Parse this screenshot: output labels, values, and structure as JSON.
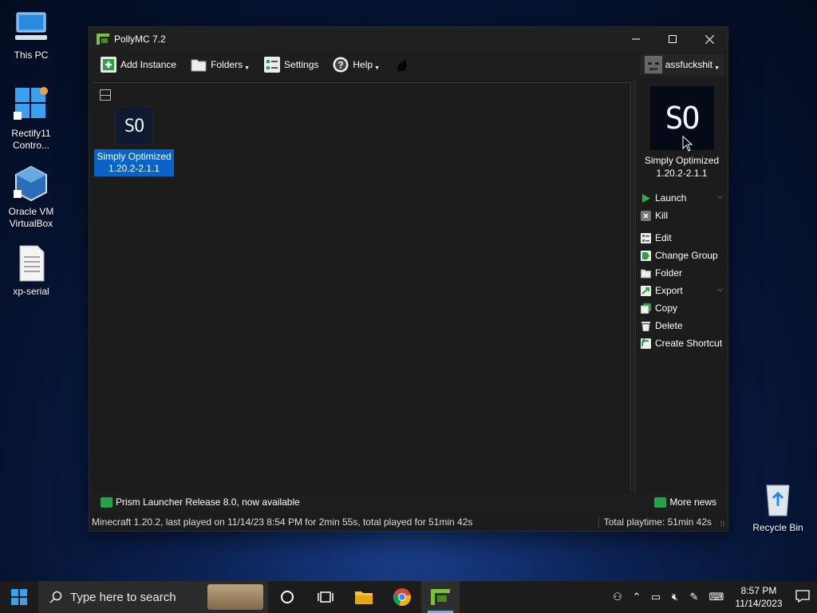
{
  "desktop": {
    "icons": [
      {
        "label": "This PC"
      },
      {
        "label": "Rectify11 Contro..."
      },
      {
        "label": "Oracle VM VirtualBox"
      },
      {
        "label": "xp-serial"
      },
      {
        "label": "Recycle Bin"
      }
    ]
  },
  "window": {
    "title": "PollyMC 7.2",
    "toolbar": {
      "add_instance": "Add Instance",
      "folders": "Folders",
      "settings": "Settings",
      "help": "Help",
      "account": "assfuckshit"
    },
    "instances": [
      {
        "icon_text": "SO",
        "name": "Simply Optimized 1.20.2-2.1.1"
      }
    ],
    "side": {
      "icon_text": "SO",
      "name": "Simply Optimized 1.20.2-2.1.1",
      "actions": {
        "launch": "Launch",
        "kill": "Kill",
        "edit": "Edit",
        "change_group": "Change Group",
        "folder": "Folder",
        "export": "Export",
        "copy": "Copy",
        "delete": "Delete",
        "create_shortcut": "Create Shortcut"
      }
    },
    "news": {
      "headline": "Prism Launcher Release 8.0, now available",
      "more": "More news"
    },
    "status": {
      "left": "Minecraft 1.20.2, last played on 11/14/23 8:54 PM for 2min 55s, total played for 51min 42s",
      "right": "Total playtime: 51min 42s"
    }
  },
  "taskbar": {
    "search_placeholder": "Type here to search",
    "time": "8:57 PM",
    "date": "11/14/2023"
  },
  "colors": {
    "accent": "#0a64c8",
    "window_bg": "#1c1c1c",
    "taskbar": "#1c1c1c"
  }
}
